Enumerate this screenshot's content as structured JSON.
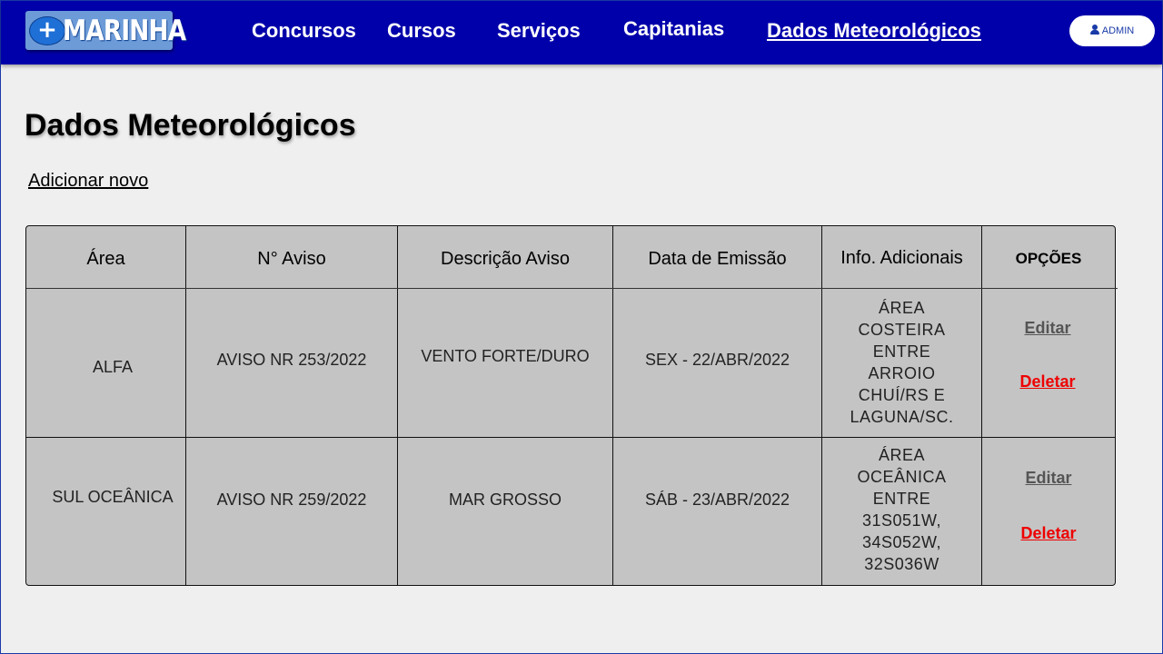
{
  "header": {
    "logo_text": "MARINHA",
    "logo_symbol": "+",
    "nav": [
      {
        "label": "Concursos"
      },
      {
        "label": "Cursos"
      },
      {
        "label": "Serviços"
      },
      {
        "label": "Capitanias"
      },
      {
        "label": "Dados Meteorológicos",
        "active": true
      }
    ],
    "admin_label": "ADMIN"
  },
  "page": {
    "title": "Dados Meteorológicos",
    "add_new_label": "Adicionar novo"
  },
  "table": {
    "headers": [
      "Área",
      "N° Aviso",
      "Descrição Aviso",
      "Data de Emissão",
      "Info. Adicionais",
      "OPÇÕES"
    ],
    "rows": [
      {
        "area": "ALFA",
        "numero": "AVISO NR 253/2022",
        "descricao": "VENTO FORTE/DURO",
        "data": "SEX - 22/ABR/2022",
        "info": "ÁREA\nCOSTEIRA\nENTRE\nARROIO\nCHUÍ/RS E\nLAGUNA/SC.",
        "edit_label": "Editar",
        "delete_label": "Deletar"
      },
      {
        "area": "SUL OCEÂNICA",
        "numero": "AVISO NR 259/2022",
        "descricao": "MAR GROSSO",
        "data": "SÁB - 23/ABR/2022",
        "info": "ÁREA\nOCEÂNICA\nENTRE\n31S051W,\n34S052W,\n32S036W",
        "edit_label": "Editar",
        "delete_label": "Deletar"
      }
    ]
  },
  "colors": {
    "navbar": "#0000aa",
    "table_bg": "#c4c4c4",
    "delete": "#ee0000"
  }
}
